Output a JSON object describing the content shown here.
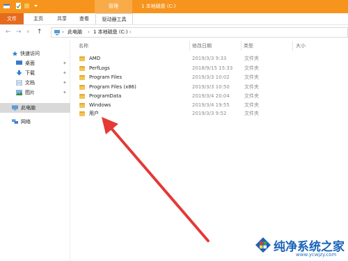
{
  "titlebar": {
    "context_tab": "管理",
    "title": "1 本地磁盘 (C:)"
  },
  "ribbon": {
    "tabs": [
      "文件",
      "主页",
      "共享",
      "查看",
      "驱动器工具"
    ]
  },
  "address": {
    "back": "←",
    "forward": "→",
    "dropdown": "∨",
    "up": "↑",
    "crumbs": [
      "此电脑",
      "1 本地磁盘 (C:)"
    ],
    "separator": "›"
  },
  "navpane": {
    "quick_access": "快速访问",
    "desktop": "桌面",
    "downloads": "下载",
    "documents": "文档",
    "pictures": "图片",
    "this_pc": "此电脑",
    "network": "网络",
    "pin": "✦"
  },
  "columns": {
    "name": "名称",
    "date": "修改日期",
    "type": "类型",
    "size": "大小"
  },
  "files": [
    {
      "name": "AMD",
      "date": "2019/3/3 9:33",
      "type": "文件夹"
    },
    {
      "name": "PerfLogs",
      "date": "2018/9/15 15:33",
      "type": "文件夹"
    },
    {
      "name": "Program Files",
      "date": "2019/3/3 10:02",
      "type": "文件夹"
    },
    {
      "name": "Program Files (x86)",
      "date": "2019/3/3 10:50",
      "type": "文件夹"
    },
    {
      "name": "ProgramData",
      "date": "2019/3/4 20:04",
      "type": "文件夹"
    },
    {
      "name": "Windows",
      "date": "2019/3/4 19:55",
      "type": "文件夹"
    },
    {
      "name": "用户",
      "date": "2019/3/3 9:52",
      "type": "文件夹"
    }
  ],
  "watermark": {
    "title": "纯净系统之家",
    "url": "www.ycwjzy.com"
  },
  "colors": {
    "titlebar": "#f7941d",
    "file_tab": "#e56b1f",
    "arrow": "#e53935",
    "folder": "#f6c453"
  }
}
